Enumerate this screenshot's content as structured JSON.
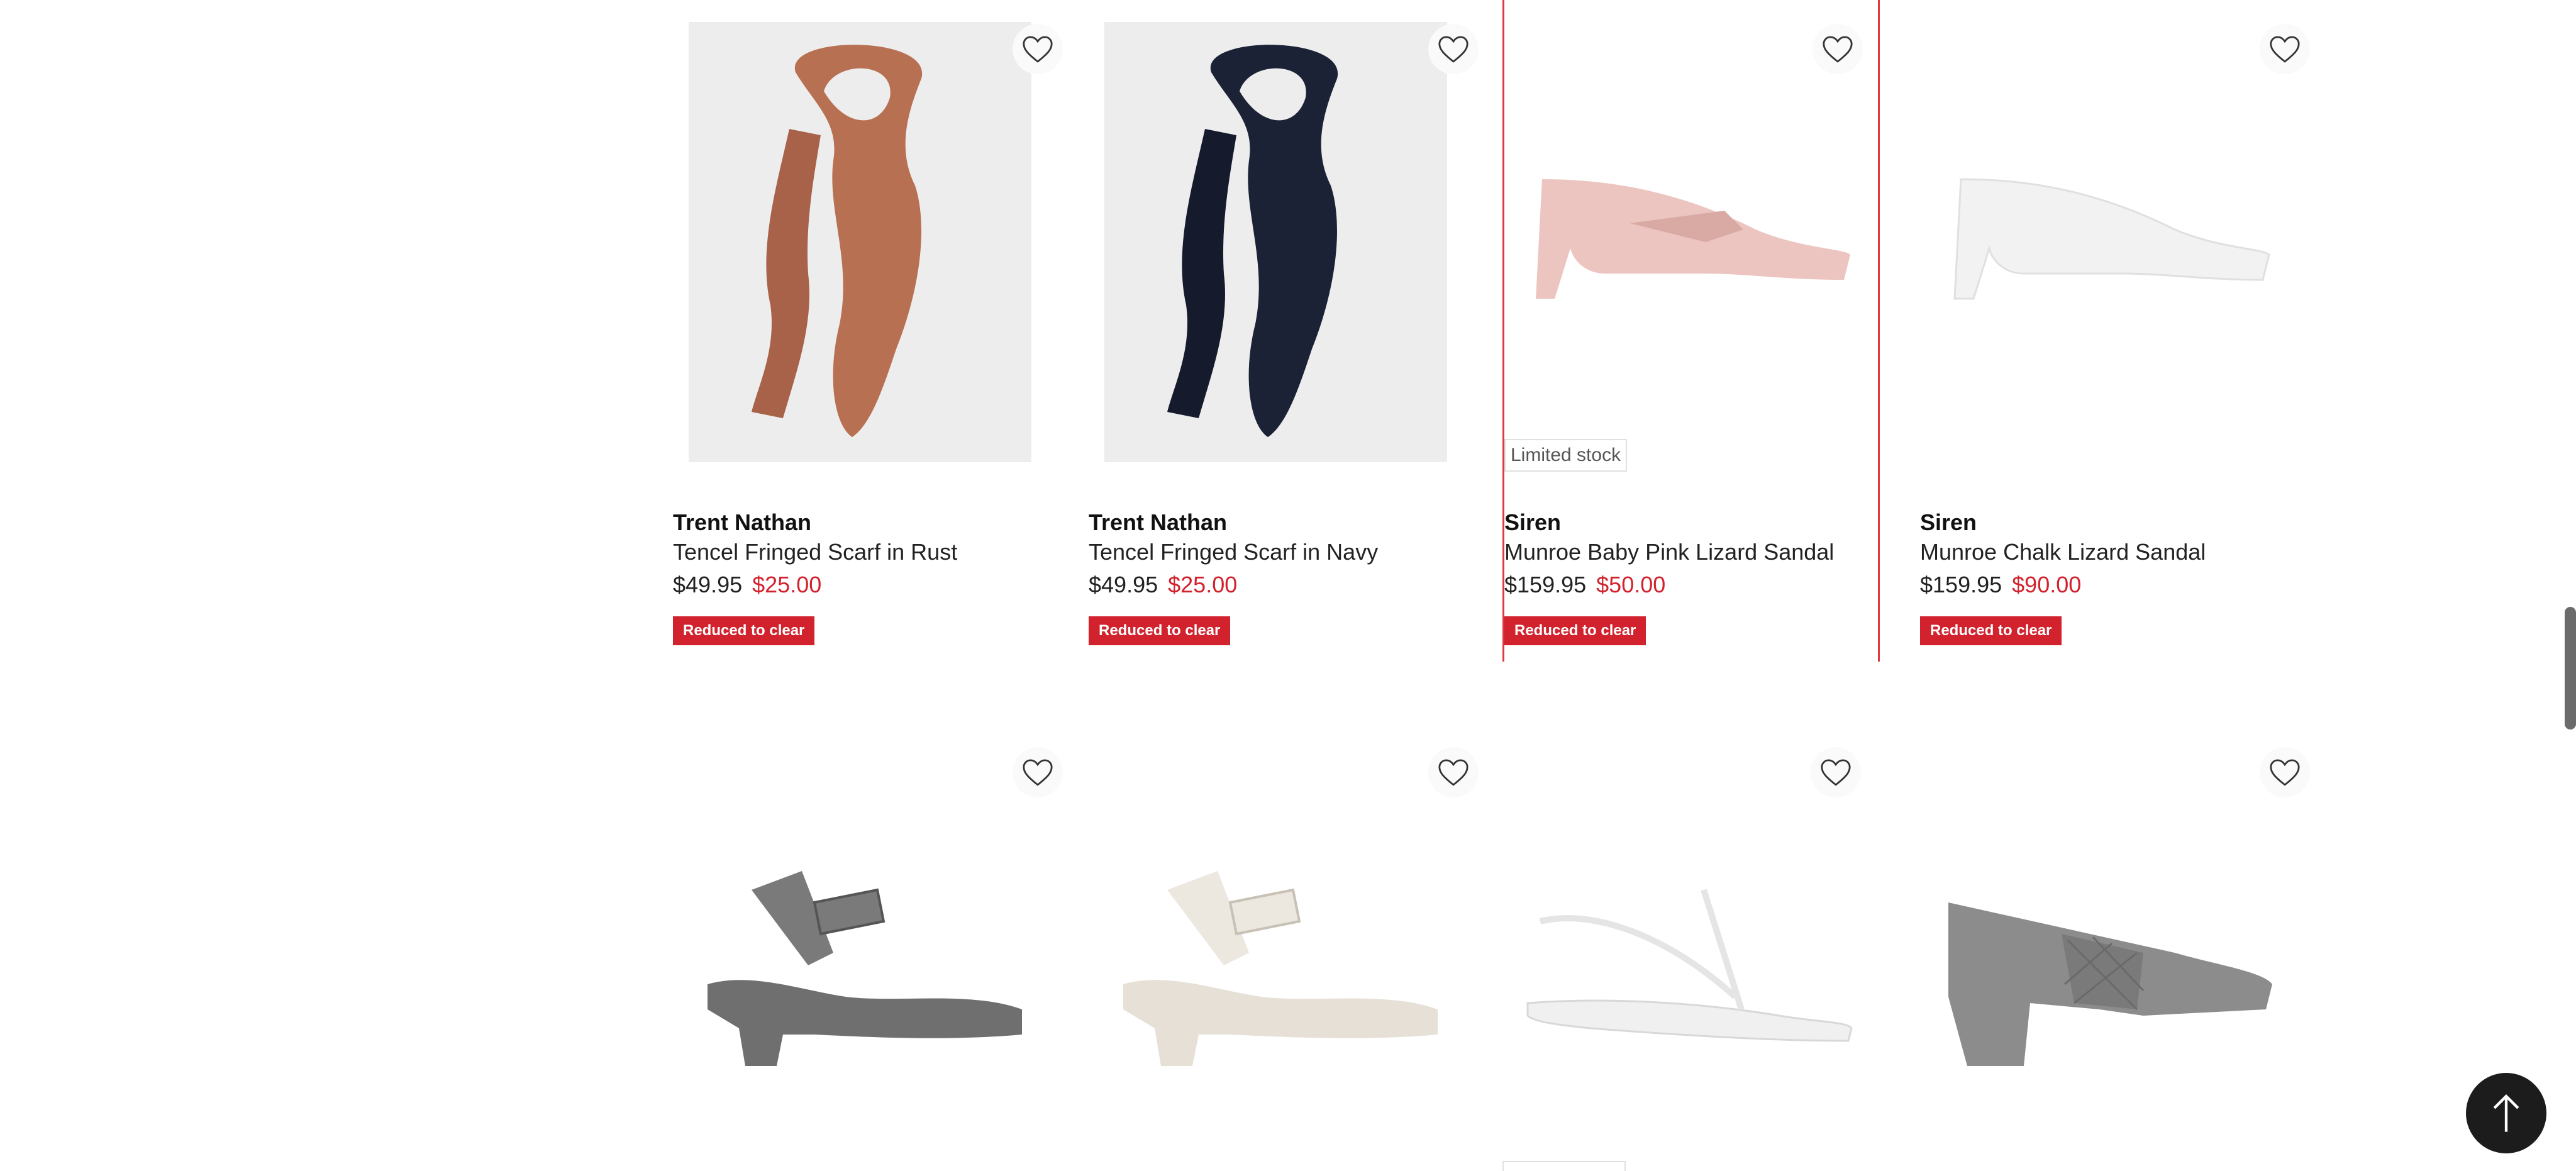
{
  "products_row1": [
    {
      "brand": "Trent Nathan",
      "name": "Tencel Fringed Scarf in Rust",
      "was_price": "$49.95",
      "now_price": "$25.00",
      "badge": "Reduced to clear",
      "stock_note": "",
      "image_icon": "rust-scarf-image"
    },
    {
      "brand": "Trent Nathan",
      "name": "Tencel Fringed Scarf in Navy",
      "was_price": "$49.95",
      "now_price": "$25.00",
      "badge": "Reduced to clear",
      "stock_note": "",
      "image_icon": "navy-scarf-image"
    },
    {
      "brand": "Siren",
      "name": "Munroe Baby Pink Lizard Sandal",
      "was_price": "$159.95",
      "now_price": "$50.00",
      "badge": "Reduced to clear",
      "stock_note": "Limited stock",
      "image_icon": "pink-sandal-image"
    },
    {
      "brand": "Siren",
      "name": "Munroe Chalk Lizard Sandal",
      "was_price": "$159.95",
      "now_price": "$90.00",
      "badge": "Reduced to clear",
      "stock_note": "",
      "image_icon": "white-sandal-image"
    }
  ],
  "products_row2": [
    {
      "image_icon": "grey-block-heel-sandal-image"
    },
    {
      "image_icon": "cream-block-heel-sandal-image"
    },
    {
      "image_icon": "white-flat-sandal-image"
    },
    {
      "image_icon": "black-quilted-mule-image"
    }
  ],
  "icons": {
    "wishlist": "heart-outline-icon",
    "back_to_top": "arrow-up-icon"
  },
  "colors": {
    "sale_red": "#d2222d",
    "hover_outline": "#e0393e",
    "back_to_top_bg": "#1c1c1c"
  }
}
